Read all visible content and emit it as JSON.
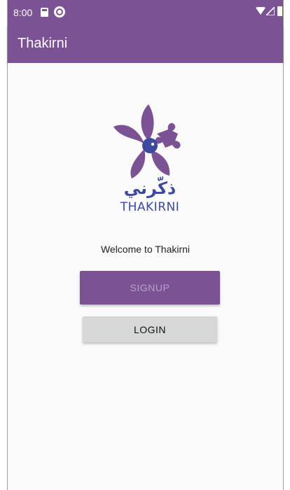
{
  "status_bar": {
    "time": "8:00",
    "icons": [
      "sd-card-icon",
      "sync-icon",
      "wifi-icon",
      "signal-icon",
      "battery-icon"
    ]
  },
  "app_bar": {
    "title": "Thakirni"
  },
  "logo": {
    "arabic_text": "ذكّرني",
    "latin_text": "THAKIRNI"
  },
  "main": {
    "welcome_text": "Welcome to Thakirni",
    "signup_label": "Signup",
    "login_label": "Login"
  },
  "colors": {
    "primary": "#7b5294",
    "signup_text": "#b8a3c8",
    "login_bg": "#d6d7d7",
    "logo_blue": "#3d4a9e",
    "logo_purple": "#7b5294"
  }
}
